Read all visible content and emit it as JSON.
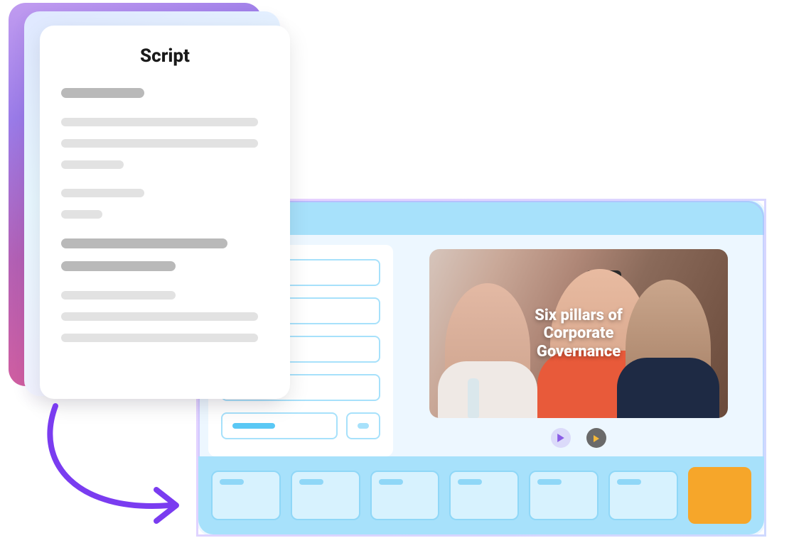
{
  "script_doc": {
    "title": "Script"
  },
  "video": {
    "title": "Six pillars of\nCorporate Governance"
  },
  "controls": {
    "play_label": "Play",
    "preview_label": "Preview"
  },
  "timeline": {
    "slot_count": 7
  },
  "icons": {
    "play": "play-icon",
    "preview": "preview-icon"
  }
}
